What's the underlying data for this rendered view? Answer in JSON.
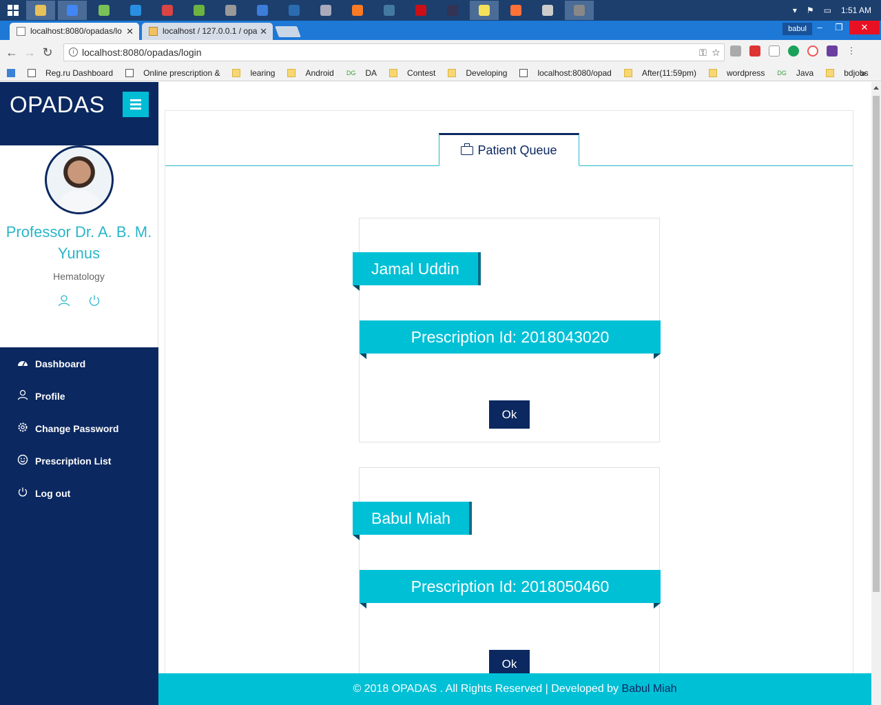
{
  "taskbar": {
    "apps": [
      "file-explorer-icon",
      "chrome-icon",
      "android-studio-icon",
      "app-icon",
      "app-icon",
      "spring-icon",
      "database-icon",
      "app-icon",
      "app-icon",
      "app-icon",
      "xampp-icon",
      "mysql-icon",
      "opera-icon",
      "app-icon",
      "notepad-icon",
      "firefox-icon",
      "app-icon",
      "settings-icon"
    ],
    "clock": "1:51 AM"
  },
  "browser": {
    "tabs": [
      {
        "title": "localhost:8080/opadas/lo"
      },
      {
        "title": "localhost / 127.0.0.1 / opa"
      }
    ],
    "user": "babul",
    "url": "localhost:8080/opadas/login"
  },
  "bookmarks": [
    {
      "label": "Reg.ru Dashboard",
      "type": "page"
    },
    {
      "label": "Online prescription &",
      "type": "page"
    },
    {
      "label": "learing",
      "type": "folder"
    },
    {
      "label": "Android",
      "type": "folder"
    },
    {
      "label": "DA",
      "type": "dg"
    },
    {
      "label": "Contest",
      "type": "folder"
    },
    {
      "label": "Developing",
      "type": "folder"
    },
    {
      "label": "localhost:8080/opad",
      "type": "page"
    },
    {
      "label": "After(11:59pm)",
      "type": "folder"
    },
    {
      "label": "wordpress",
      "type": "folder"
    },
    {
      "label": "Java",
      "type": "dg"
    },
    {
      "label": "bdjobs",
      "type": "folder"
    }
  ],
  "sidebar": {
    "brand": "OPADAS",
    "doctor_name": "Professor Dr. A. B. M. Yunus",
    "specialty": "Hematology",
    "nav": [
      {
        "label": "Dashboard",
        "icon": "dashboard-icon"
      },
      {
        "label": "Profile",
        "icon": "user-icon"
      },
      {
        "label": "Change Password",
        "icon": "gear-icon"
      },
      {
        "label": "Prescription List",
        "icon": "smile-icon"
      },
      {
        "label": "Log out",
        "icon": "power-icon"
      }
    ]
  },
  "main": {
    "tab_label": "Patient Queue",
    "patients": [
      {
        "name": "Jamal Uddin",
        "prescription": "Prescription Id: 2018043020",
        "button": "Ok"
      },
      {
        "name": "Babul Miah",
        "prescription": "Prescription Id: 2018050460",
        "button": "Ok"
      }
    ]
  },
  "footer": {
    "text": "© 2018 OPADAS . All Rights Reserved | Developed by",
    "developer": "Babul Miah"
  },
  "colors": {
    "navy": "#0b2860",
    "cyan": "#00c0d6",
    "taskbar": "#1c3f6e",
    "tabstrip": "#1d78d6"
  }
}
